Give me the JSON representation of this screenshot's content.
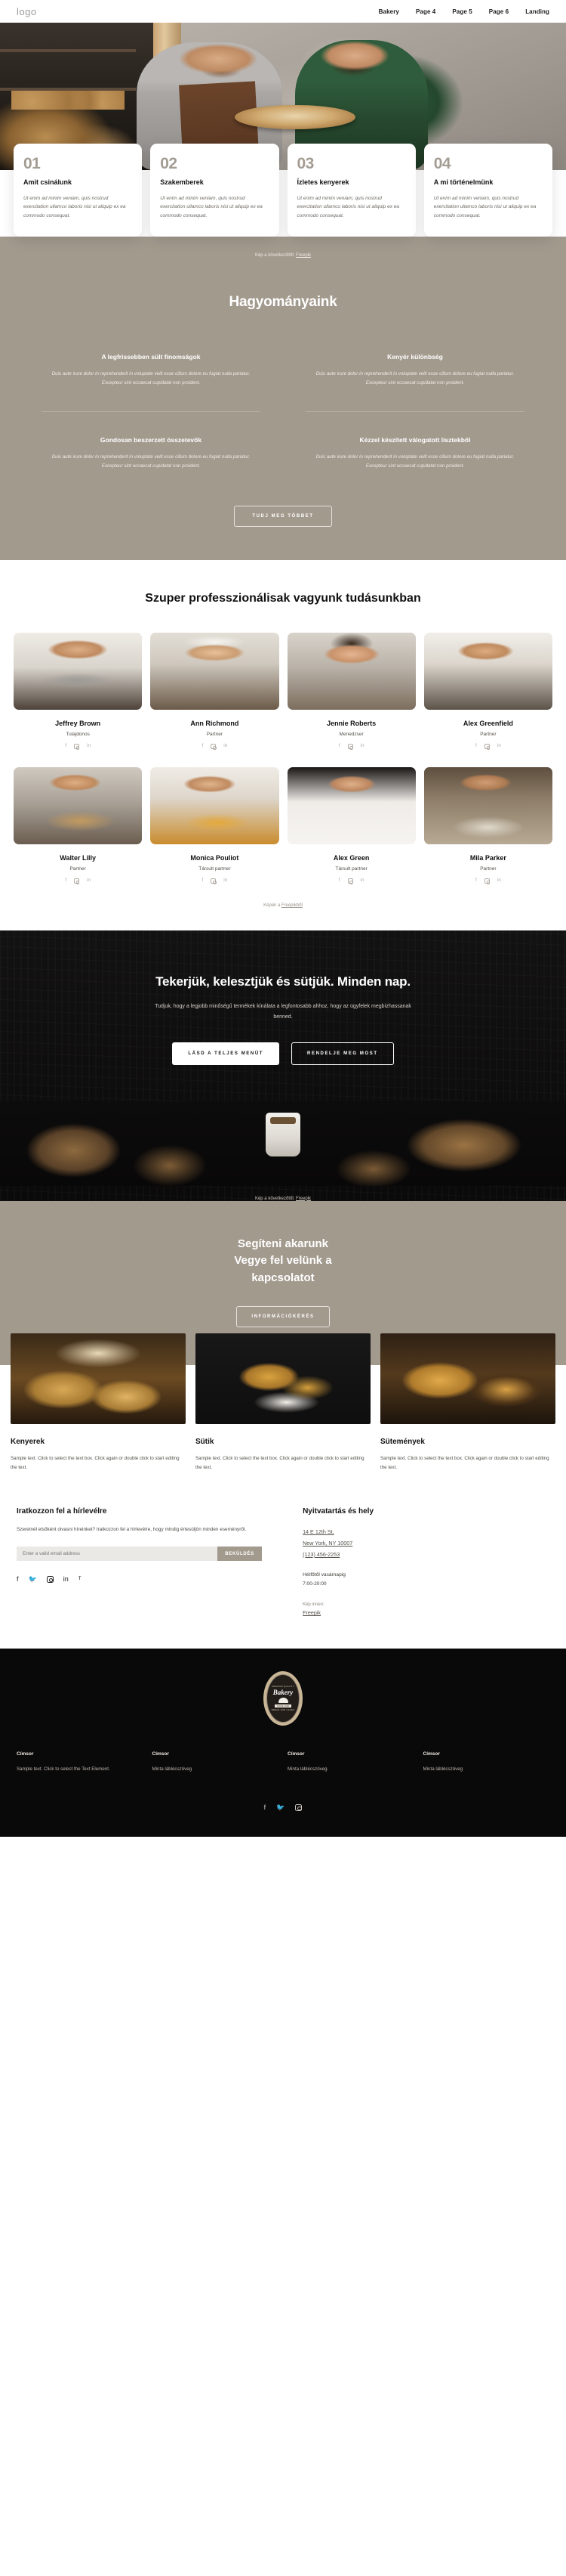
{
  "header": {
    "logo": "logo",
    "nav": [
      {
        "label": "Bakery"
      },
      {
        "label": "Page 4"
      },
      {
        "label": "Page 5"
      },
      {
        "label": "Page 6"
      },
      {
        "label": "Landing"
      }
    ]
  },
  "feature_cards": [
    {
      "num": "01",
      "title": "Amit csinálunk",
      "desc": "Ut enim ad minim veniam, quis nostrud exercitation ullamco laboris nisi ut aliquip ex ea commodo consequat."
    },
    {
      "num": "02",
      "title": "Szakemberek",
      "desc": "Ut enim ad minim veniam, quis nostrud exercitation ullamco laboris nisi ut aliquip ex ea commodo consequat."
    },
    {
      "num": "03",
      "title": "Ízletes kenyerek",
      "desc": "Ut enim ad minim veniam, quis nostrud exercitation ullamco laboris nisi ut aliquip ex ea commodo consequat."
    },
    {
      "num": "04",
      "title": "A mi történelmünk",
      "desc": "Ut enim ad minim veniam, quis nostrud exercitation ullamco laboris nisi ut aliquip ex ea commodo consequat."
    }
  ],
  "credits": {
    "prefix": "Kép a következőtől:",
    "source": "Freepik",
    "team_prefix": "Képek a",
    "team_source": "Freepikből",
    "plain_prefix": "Kép innen:",
    "plain_source": "Freepik"
  },
  "traditions": {
    "title": "Hagyományaink",
    "items": [
      {
        "title": "A legfrissebben sült finomságok",
        "desc": "Duis aute irure dolor in reprehenderit in voluptate velit esse cillum dolore eu fugiat nulla pariatur. Excepteur sint occaecat cupidatat non proident."
      },
      {
        "title": "Kenyér különbség",
        "desc": "Duis aute irure dolor in reprehenderit in voluptate velit esse cillum dolore eu fugiat nulla pariatur. Excepteur sint occaecat cupidatat non proident."
      },
      {
        "title": "Gondosan beszerzett összetevők",
        "desc": "Duis aute irure dolor in reprehenderit in voluptate velit esse cillum dolore eu fugiat nulla pariatur. Excepteur sint occaecat cupidatat non proident."
      },
      {
        "title": "Kézzel készített válogatott lisztekből",
        "desc": "Duis aute irure dolor in reprehenderit in voluptate velit esse cillum dolore eu fugiat nulla pariatur. Excepteur sint occaecat cupidatat non proident."
      }
    ],
    "button": "TUDJ MEG TÖBBET"
  },
  "team": {
    "title": "Szuper professzionálisak vagyunk tudásunkban",
    "members": [
      {
        "name": "Jeffrey Brown",
        "role": "Tulajdonos"
      },
      {
        "name": "Ann Richmond",
        "role": "Partner"
      },
      {
        "name": "Jennie Roberts",
        "role": "Menedzser"
      },
      {
        "name": "Alex Greenfield",
        "role": "Partner"
      },
      {
        "name": "Walter Lilly",
        "role": "Partner"
      },
      {
        "name": "Monica Pouliot",
        "role": "Társult partner"
      },
      {
        "name": "Alex Green",
        "role": "Társult partner"
      },
      {
        "name": "Mila Parker",
        "role": "Partner"
      }
    ],
    "social": [
      "f",
      "instagram",
      "in"
    ]
  },
  "cta": {
    "title": "Tekerjük, kelesztjük és sütjük. Minden nap.",
    "desc": "Tudjuk, hogy a legjobb minőségű termékek kínálata a legfontosabb ahhoz, hogy az ügyfelek megbízhassanak benned.",
    "primary_button": "LÁSD A TELJES MENÜT",
    "secondary_button": "RENDELJE MEG MOST"
  },
  "contact": {
    "title_line1": "Segíteni akarunk",
    "title_line2": "Vegye fel velünk a",
    "title_line3": "kapcsolatot",
    "button": "INFORMÁCIÓKÉRÉS"
  },
  "products": [
    {
      "title": "Kenyerek",
      "desc": "Sample text. Click to select the text box. Click again or double click to start editing the text."
    },
    {
      "title": "Sütik",
      "desc": "Sample text. Click to select the text box. Click again or double click to start editing the text."
    },
    {
      "title": "Sütemények",
      "desc": "Sample text. Click to select the text box. Click again or double click to start editing the text."
    }
  ],
  "newsletter": {
    "title": "Iratkozzon fel a hírlevélre",
    "desc": "Szeretnél elsőként olvasni híreinket? Iratkozzon fel a hírlevélre, hogy mindig értesüljön minden eseményről.",
    "placeholder": "Enter a valid email address",
    "value": "",
    "button": "BEKÜLDÉS",
    "social": [
      "f",
      "twitter",
      "instagram",
      "in",
      "pinterest"
    ]
  },
  "hours": {
    "title": "Nyitvatartás és hely",
    "address_line1": "14 E 12th St,",
    "address_line2": "New York, NY 10007",
    "phone": "(123) 456-2253",
    "days": "Hétfőtől vasárnapig",
    "time": "7:00-20:00"
  },
  "footer": {
    "badge": {
      "top": "PREMIUM QUALITY",
      "name": "Bakery",
      "since": "SINCE 2008",
      "bottom": "BREAD AND CAKES"
    },
    "columns": [
      {
        "heading": "Címsor",
        "text": "Sample text. Click to select the Text Element."
      },
      {
        "heading": "Címsor",
        "text": "Minta láblécszöveg"
      },
      {
        "heading": "Címsor",
        "text": "Minta láblécszöveg"
      },
      {
        "heading": "Címsor",
        "text": "Minta láblécszöveg"
      }
    ],
    "social": [
      "f",
      "twitter",
      "instagram"
    ]
  },
  "colors": {
    "beige": "#a39a8e",
    "dark": "#0a0909",
    "accent_number": "#a39c93"
  }
}
